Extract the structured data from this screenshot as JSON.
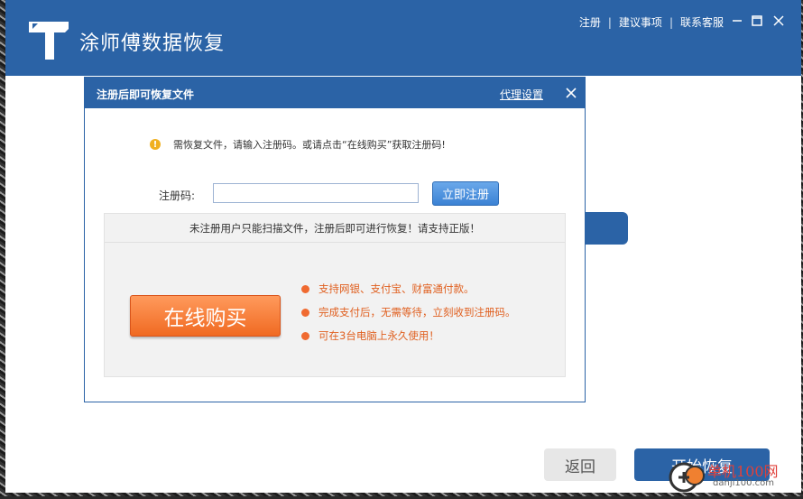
{
  "app": {
    "title": "涂师傅数据恢复",
    "top_links": [
      "注册",
      "建议事项",
      "联系客服"
    ]
  },
  "main": {
    "back_label": "返回",
    "start_label": "开始恢复"
  },
  "dialog": {
    "title": "注册后即可恢复文件",
    "proxy_link": "代理设置",
    "notice": "需恢复文件，请输入注册码。或请点击“在线购买”获取注册码!",
    "reg_label": "注册码:",
    "reg_value": "",
    "reg_button": "立即注册",
    "info_header": "未注册用户只能扫描文件，注册后即可进行恢复！请支持正版！",
    "buy_button": "在线购买",
    "features": [
      "支持网银、支付宝、财富通付款。",
      "完成支付后，无需等待，立刻收到注册码。",
      "可在3台电脑上永久使用！"
    ]
  },
  "watermark": {
    "text": "单机100网",
    "sub": "danji100.com"
  },
  "colors": {
    "primary": "#2b63a6",
    "buy_orange": "#f06a22",
    "feature_text": "#e06020"
  },
  "icons": [
    "logo-t-icon",
    "minimize-icon",
    "maximize-icon",
    "close-icon",
    "warning-icon",
    "bullet-icon"
  ]
}
